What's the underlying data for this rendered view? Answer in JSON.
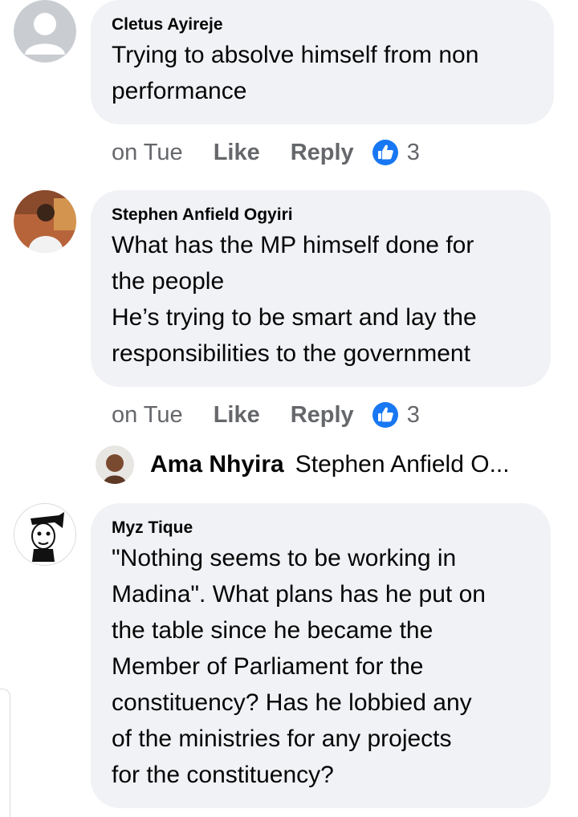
{
  "comments": [
    {
      "author": "Cletus Ayireje",
      "text": "Trying to absolve himself from non\nperformance",
      "time": "on Tue",
      "like": "Like",
      "reply": "Reply",
      "reactions": "3"
    },
    {
      "author": "Stephen Anfield Ogyiri",
      "text": "What has the MP himself done for\nthe people\nHe’s trying to be smart and lay the\nresponsibilities to the government",
      "time": "on Tue",
      "like": "Like",
      "reply": "Reply",
      "reactions": "3"
    },
    {
      "author": "Myz Tique",
      "text": "\"Nothing seems to be working in\nMadina\". What plans has he put on\nthe table since he became the\nMember of Parliament for the\nconstituency? Has he lobbied any\nof the ministries for any projects\nfor the constituency?"
    }
  ],
  "reply_preview": {
    "author": "Ama Nhyira",
    "text": "Stephen Anfield O..."
  },
  "colors": {
    "bubble": "#f0f2f5",
    "meta": "#65676b",
    "like_blue": "#1877f2"
  }
}
